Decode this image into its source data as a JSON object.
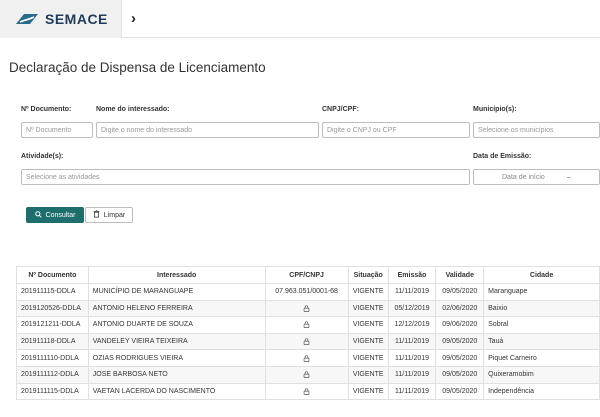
{
  "brand": {
    "name": "SEMACE"
  },
  "page": {
    "title": "Declaração de Dispensa de Licenciamento"
  },
  "filters": {
    "numero": {
      "label": "Nº Documento:",
      "placeholder": "Nº Documento"
    },
    "interessado": {
      "label": "Nome do interessado:",
      "placeholder": "Digite o nome do interessado"
    },
    "cpf": {
      "label": "CNPJ/CPF:",
      "placeholder": "Digite o CNPJ ou CPF"
    },
    "municipio": {
      "label": "Município(s):",
      "placeholder": "Selecione os municípios"
    },
    "atividade": {
      "label": "Atividade(s):",
      "placeholder": "Selecione as atividades"
    },
    "emissao": {
      "label": "Data de Emissão:",
      "start_placeholder": "Data de início",
      "separator": "–"
    }
  },
  "actions": {
    "consultar": "Consultar",
    "limpar": "Limpar"
  },
  "table": {
    "headers": [
      "Nº Documento",
      "Interessado",
      "CPF/CNPJ",
      "Situação",
      "Emissão",
      "Validade",
      "Cidade"
    ],
    "rows": [
      {
        "numero": "201911115-DDLA",
        "interessado": "MUNICÍPIO DE MARANGUAPE",
        "cpf": "07.963.051/0001-68",
        "locked": false,
        "situacao": "VIGENTE",
        "emissao": "11/11/2019",
        "validade": "09/05/2020",
        "cidade": "Maranguape"
      },
      {
        "numero": "2019120526-DDLA",
        "interessado": "ANTONIO HELENO FERREIRA",
        "cpf": "",
        "locked": true,
        "situacao": "VIGENTE",
        "emissao": "05/12/2019",
        "validade": "02/06/2020",
        "cidade": "Baixio"
      },
      {
        "numero": "2019121211-DDLA",
        "interessado": "ANTONIO DUARTE DE SOUZA",
        "cpf": "",
        "locked": true,
        "situacao": "VIGENTE",
        "emissao": "12/12/2019",
        "validade": "09/06/2020",
        "cidade": "Sobral"
      },
      {
        "numero": "201911118-DDLA",
        "interessado": "VANDELEY VIEIRA TEIXEIRA",
        "cpf": "",
        "locked": true,
        "situacao": "VIGENTE",
        "emissao": "11/11/2019",
        "validade": "09/05/2020",
        "cidade": "Tauá"
      },
      {
        "numero": "2019111110-DDLA",
        "interessado": "OZIAS RODRIGUES VIEIRA",
        "cpf": "",
        "locked": true,
        "situacao": "VIGENTE",
        "emissao": "11/11/2019",
        "validade": "09/05/2020",
        "cidade": "Piquet Carneiro"
      },
      {
        "numero": "2019111112-DDLA",
        "interessado": "JOSE BARBOSA NETO",
        "cpf": "",
        "locked": true,
        "situacao": "VIGENTE",
        "emissao": "11/11/2019",
        "validade": "09/05/2020",
        "cidade": "Quixeramobim"
      },
      {
        "numero": "2019111115-DDLA",
        "interessado": "VAETAN LACERDA DO NASCIMENTO",
        "cpf": "",
        "locked": true,
        "situacao": "VIGENTE",
        "emissao": "11/11/2019",
        "validade": "09/05/2020",
        "cidade": "Independência"
      }
    ]
  },
  "colors": {
    "primary_button": "#1f6e6e",
    "brand_text": "#1f3b5a",
    "brand_mark": "#2a6a8a"
  }
}
